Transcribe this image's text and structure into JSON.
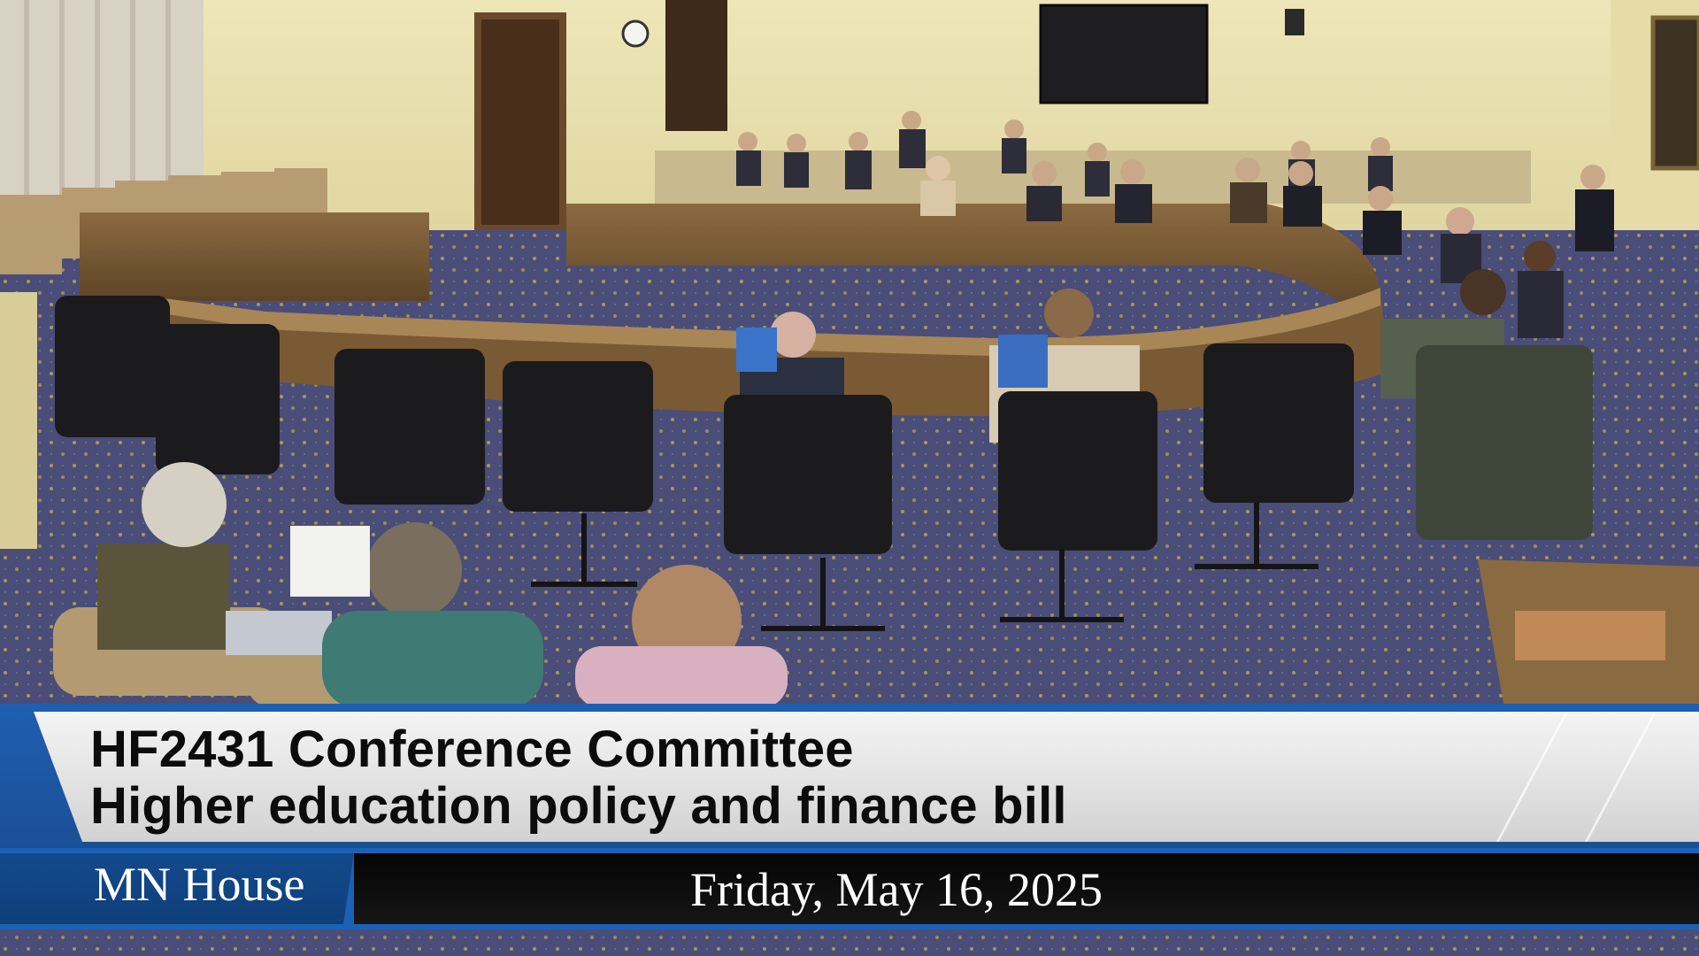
{
  "chyron": {
    "title_line1": "HF2431 Conference Committee",
    "title_line2": "Higher education policy and finance bill",
    "organization": "MN House",
    "date": "Friday, May 16, 2025"
  },
  "colors": {
    "banner_blue": "#1b62b6",
    "org_box_blue": "#124a8c",
    "date_box_black": "#0a0a0a",
    "title_panel_gray": "#e6e6e6"
  }
}
